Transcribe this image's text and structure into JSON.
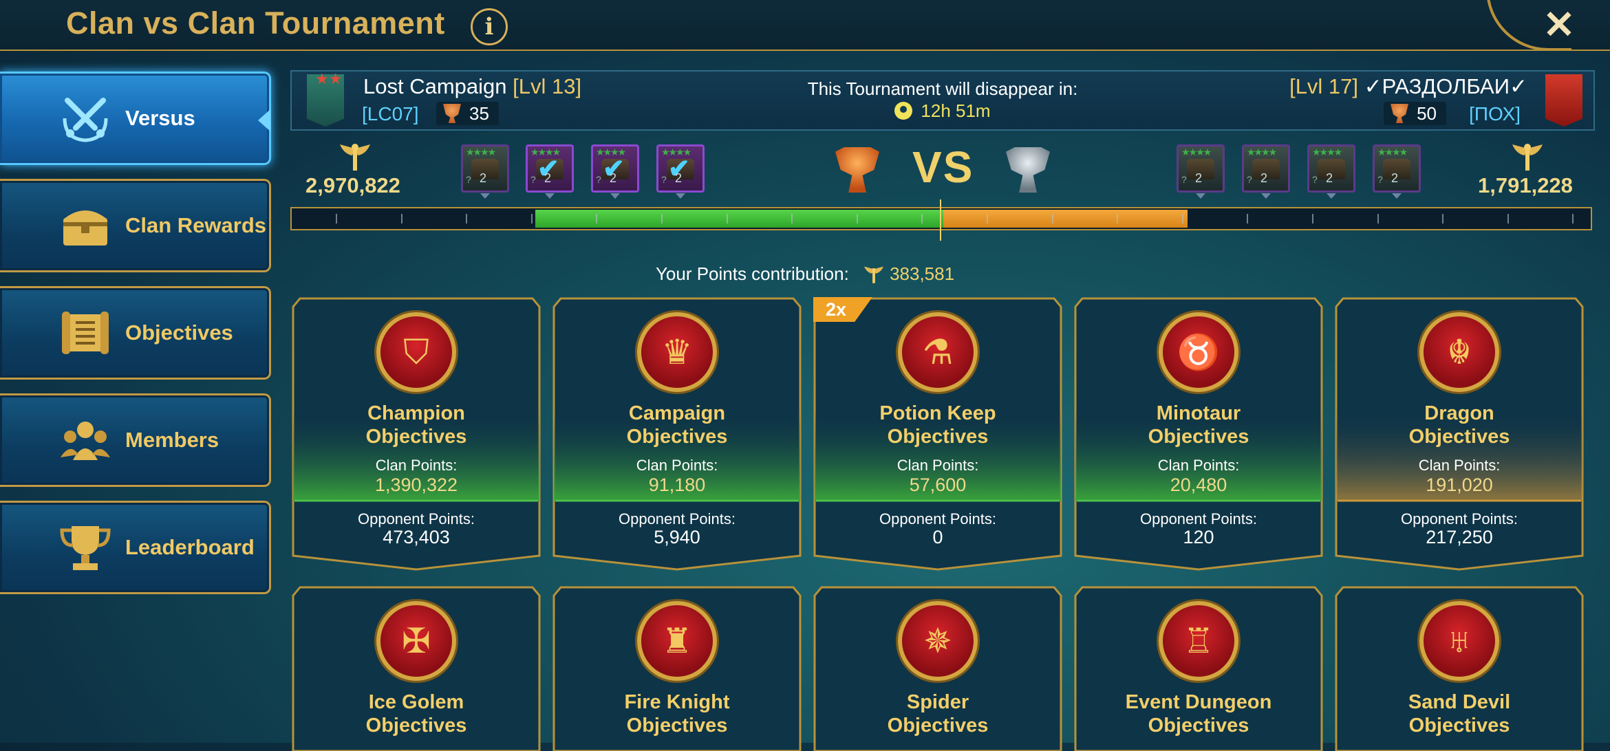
{
  "header": {
    "title": "Clan vs Clan Tournament",
    "info_icon": "i",
    "close_icon": "✕"
  },
  "sidebar": {
    "items": [
      {
        "label": "Versus",
        "icon": "crossed-swords-icon",
        "active": true
      },
      {
        "label": "Clan Rewards",
        "icon": "treasure-chest-icon",
        "active": false
      },
      {
        "label": "Objectives",
        "icon": "scroll-icon",
        "active": false
      },
      {
        "label": "Members",
        "icon": "members-icon",
        "active": false
      },
      {
        "label": "Leaderboard",
        "icon": "trophy-icon",
        "active": false
      }
    ]
  },
  "match": {
    "my_clan": {
      "name": "Lost Campaign",
      "level": "[Lvl 13]",
      "tag": "[LC07]",
      "trophies": "35",
      "score": "2,970,822"
    },
    "opponent": {
      "name": "✓РАЗДОЛБАИ✓",
      "level": "[Lvl 17]",
      "tag": "[ПОХ]",
      "trophies": "50",
      "score": "1,791,228"
    },
    "disappear_text": "This Tournament will disappear in:",
    "timer": "12h 51m",
    "vs": "VS",
    "progress": {
      "my_share": 0.625,
      "opp_share": 0.375
    }
  },
  "chests": {
    "left": [
      {
        "num": "2",
        "q": "?",
        "done": false
      },
      {
        "num": "2",
        "q": "?",
        "done": true
      },
      {
        "num": "2",
        "q": "?",
        "done": true
      },
      {
        "num": "2",
        "q": "?",
        "done": true
      }
    ],
    "right": [
      {
        "num": "2",
        "q": "?",
        "done": false
      },
      {
        "num": "2",
        "q": "?",
        "done": false
      },
      {
        "num": "2",
        "q": "?",
        "done": false
      },
      {
        "num": "2",
        "q": "?",
        "done": false
      }
    ]
  },
  "contribution": {
    "label": "Your Points contribution:",
    "value": "383,581"
  },
  "cards_row1": [
    {
      "title1": "Champion",
      "title2": "Objectives",
      "clan_label": "Clan Points:",
      "clan_points": "1,390,322",
      "opp_label": "Opponent Points:",
      "opp_points": "473,403",
      "icon": "helmet-icon",
      "glyph": "⛉",
      "leading": "clan"
    },
    {
      "title1": "Campaign",
      "title2": "Objectives",
      "clan_label": "Clan Points:",
      "clan_points": "91,180",
      "opp_label": "Opponent Points:",
      "opp_points": "5,940",
      "icon": "crown-icon",
      "glyph": "♛",
      "leading": "clan"
    },
    {
      "title1": "Potion Keep",
      "title2": "Objectives",
      "clan_label": "Clan Points:",
      "clan_points": "57,600",
      "opp_label": "Opponent Points:",
      "opp_points": "0",
      "icon": "potion-icon",
      "glyph": "⚗",
      "leading": "clan",
      "badge": "2x"
    },
    {
      "title1": "Minotaur",
      "title2": "Objectives",
      "clan_label": "Clan Points:",
      "clan_points": "20,480",
      "opp_label": "Opponent Points:",
      "opp_points": "120",
      "icon": "minotaur-icon",
      "glyph": "♉",
      "leading": "clan"
    },
    {
      "title1": "Dragon",
      "title2": "Objectives",
      "clan_label": "Clan Points:",
      "clan_points": "191,020",
      "opp_label": "Opponent Points:",
      "opp_points": "217,250",
      "icon": "dragon-icon",
      "glyph": "☬",
      "leading": "opponent"
    }
  ],
  "cards_row2": [
    {
      "title1": "Ice Golem",
      "title2": "Objectives",
      "icon": "golem-icon",
      "glyph": "✠"
    },
    {
      "title1": "Fire Knight",
      "title2": "Objectives",
      "icon": "fire-knight-icon",
      "glyph": "♜"
    },
    {
      "title1": "Spider",
      "title2": "Objectives",
      "icon": "spider-icon",
      "glyph": "✵"
    },
    {
      "title1": "Event Dungeon",
      "title2": "Objectives",
      "icon": "dungeon-icon",
      "glyph": "♖"
    },
    {
      "title1": "Sand Devil",
      "title2": "Objectives",
      "icon": "sand-devil-icon",
      "glyph": "♅"
    }
  ],
  "colors": {
    "gold": "#d8b15a",
    "green_glow": "#3aa63a",
    "orange_glow": "#d78418",
    "active_tab": "#1f7fd0"
  }
}
